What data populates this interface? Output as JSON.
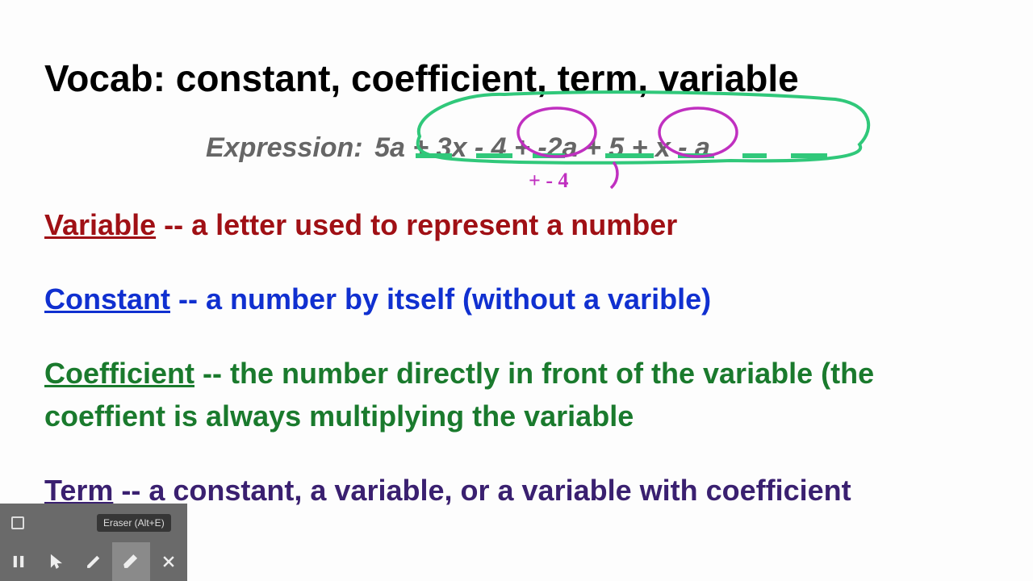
{
  "title": "Vocab:  constant, coefficient, term, variable",
  "expression": {
    "label": "Expression:",
    "body": "5a + 3x - 4 + -2a + 5 + x - a",
    "handwriting": "+ - 4"
  },
  "defs": {
    "variable": {
      "keyword": "Variable",
      "text": " -- a letter used to represent a number"
    },
    "constant": {
      "keyword": "Constant",
      "text": " -- a number by itself (without a varible)"
    },
    "coefficient": {
      "keyword": "Coefficient",
      "text": " -- the number directly in front of the variable (the coeffient is always multiplying the variable"
    },
    "term": {
      "keyword": "Term",
      "text": " -- a constant, a variable, or a variable with coefficient"
    }
  },
  "toolbar": {
    "tooltip": "Eraser (Alt+E)"
  }
}
